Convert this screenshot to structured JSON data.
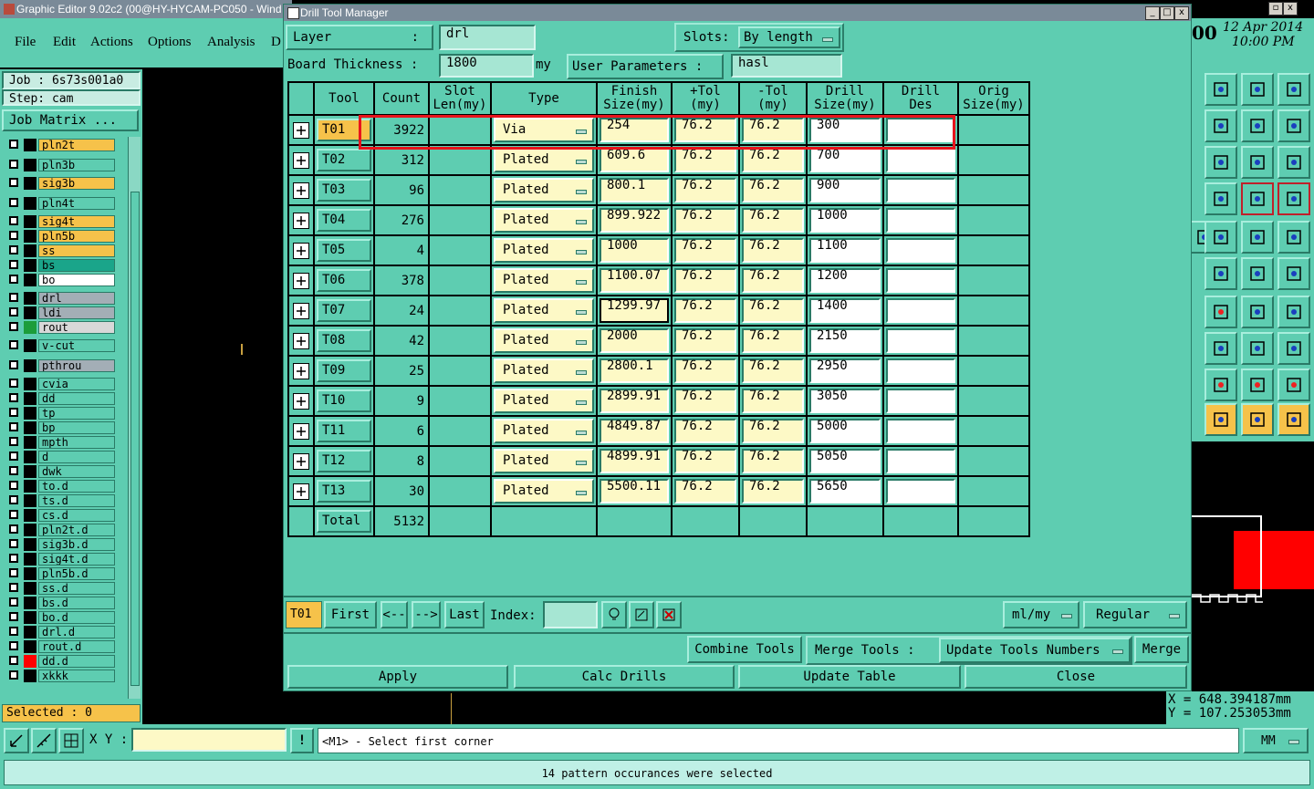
{
  "app": {
    "title": "Graphic Editor 9.02c2 (00@HY-HYCAM-PC050 - Wind",
    "menu": [
      "File",
      "Edit",
      "Actions",
      "Options",
      "Analysis",
      "D"
    ],
    "job_label": "Job : 6s73s001a0",
    "step_label": "Step: cam",
    "job_matrix_button": "Job Matrix ...",
    "selected_label": "Selected : 0",
    "xy_label": "X Y :",
    "prompt": "<M1> - Select first corner",
    "units": "MM",
    "status_message": "14 pattern occurances were selected",
    "date": "12 Apr 2014",
    "time": "10:00 PM",
    "time_prefix": "00",
    "coord_x": "X = 648.394187mm",
    "coord_y": "Y = 107.253053mm",
    "layers": [
      {
        "name": "pln2t",
        "color": "#f6c24a"
      },
      {
        "name": "pln3b",
        "color": "#5ecdb1"
      },
      {
        "name": "sig3b",
        "color": "#f6c24a"
      },
      {
        "name": "pln4t",
        "color": "#5ecdb1"
      },
      {
        "name": "sig4t",
        "color": "#f6c24a"
      },
      {
        "name": "pln5b",
        "color": "#f6c24a"
      },
      {
        "name": "ss",
        "color": "#f6c24a"
      },
      {
        "name": "bs",
        "color": "#1aa58a"
      },
      {
        "name": "bo",
        "color": "#ffffff"
      },
      {
        "name": "drl",
        "color": "#a3aeb6"
      },
      {
        "name": "ldi",
        "color": "#a3aeb6"
      },
      {
        "name": "rout",
        "color": "#d8d8d8"
      },
      {
        "name": "v-cut",
        "color": "#5ecdb1"
      },
      {
        "name": "pthrou",
        "color": "#a3aeb6"
      },
      {
        "name": "cvia",
        "color": "#5ecdb1"
      },
      {
        "name": "dd",
        "color": "#5ecdb1"
      },
      {
        "name": "tp",
        "color": "#5ecdb1"
      },
      {
        "name": "bp",
        "color": "#5ecdb1"
      },
      {
        "name": "mpth",
        "color": "#5ecdb1"
      },
      {
        "name": "d",
        "color": "#5ecdb1"
      },
      {
        "name": "dwk",
        "color": "#5ecdb1"
      },
      {
        "name": "to.d",
        "color": "#5ecdb1"
      },
      {
        "name": "ts.d",
        "color": "#5ecdb1"
      },
      {
        "name": "cs.d",
        "color": "#5ecdb1"
      },
      {
        "name": "pln2t.d",
        "color": "#5ecdb1"
      },
      {
        "name": "sig3b.d",
        "color": "#5ecdb1"
      },
      {
        "name": "sig4t.d",
        "color": "#5ecdb1"
      },
      {
        "name": "pln5b.d",
        "color": "#5ecdb1"
      },
      {
        "name": "ss.d",
        "color": "#5ecdb1"
      },
      {
        "name": "bs.d",
        "color": "#5ecdb1"
      },
      {
        "name": "bo.d",
        "color": "#5ecdb1"
      },
      {
        "name": "drl.d",
        "color": "#5ecdb1"
      },
      {
        "name": "rout.d",
        "color": "#5ecdb1"
      },
      {
        "name": "dd.d",
        "color": "#5ecdb1"
      },
      {
        "name": "xkkk",
        "color": "#5ecdb1"
      }
    ]
  },
  "dialog": {
    "title": "Drill Tool Manager",
    "layer_label": "Layer",
    "layer_value": "drl",
    "slots_label": "Slots:",
    "slots_value": "By length",
    "board_thickness_label": "Board Thickness :",
    "board_thickness_value": "1800",
    "board_thickness_unit": "my",
    "user_params_label": "User Parameters :",
    "user_params_value": "hasl",
    "columns": [
      "Tool",
      "Count",
      "Slot Len(my)",
      "Type",
      "Finish Size(my)",
      "+Tol (my)",
      "-Tol (my)",
      "Drill Size(my)",
      "Drill Des",
      "Orig Size(my)"
    ],
    "rows": [
      {
        "tool": "T01",
        "count": "3922",
        "type": "Via",
        "finish": "254",
        "ptol": "76.2",
        "mtol": "76.2",
        "drill": "300"
      },
      {
        "tool": "T02",
        "count": "312",
        "type": "Plated",
        "finish": "609.6",
        "ptol": "76.2",
        "mtol": "76.2",
        "drill": "700"
      },
      {
        "tool": "T03",
        "count": "96",
        "type": "Plated",
        "finish": "800.1",
        "ptol": "76.2",
        "mtol": "76.2",
        "drill": "900"
      },
      {
        "tool": "T04",
        "count": "276",
        "type": "Plated",
        "finish": "899.922",
        "ptol": "76.2",
        "mtol": "76.2",
        "drill": "1000"
      },
      {
        "tool": "T05",
        "count": "4",
        "type": "Plated",
        "finish": "1000",
        "ptol": "76.2",
        "mtol": "76.2",
        "drill": "1100"
      },
      {
        "tool": "T06",
        "count": "378",
        "type": "Plated",
        "finish": "1100.07",
        "ptol": "76.2",
        "mtol": "76.2",
        "drill": "1200"
      },
      {
        "tool": "T07",
        "count": "24",
        "type": "Plated",
        "finish": "1299.97",
        "ptol": "76.2",
        "mtol": "76.2",
        "drill": "1400"
      },
      {
        "tool": "T08",
        "count": "42",
        "type": "Plated",
        "finish": "2000",
        "ptol": "76.2",
        "mtol": "76.2",
        "drill": "2150"
      },
      {
        "tool": "T09",
        "count": "25",
        "type": "Plated",
        "finish": "2800.1",
        "ptol": "76.2",
        "mtol": "76.2",
        "drill": "2950"
      },
      {
        "tool": "T10",
        "count": "9",
        "type": "Plated",
        "finish": "2899.91",
        "ptol": "76.2",
        "mtol": "76.2",
        "drill": "3050"
      },
      {
        "tool": "T11",
        "count": "6",
        "type": "Plated",
        "finish": "4849.87",
        "ptol": "76.2",
        "mtol": "76.2",
        "drill": "5000"
      },
      {
        "tool": "T12",
        "count": "8",
        "type": "Plated",
        "finish": "4899.91",
        "ptol": "76.2",
        "mtol": "76.2",
        "drill": "5050"
      },
      {
        "tool": "T13",
        "count": "30",
        "type": "Plated",
        "finish": "5500.11",
        "ptol": "76.2",
        "mtol": "76.2",
        "drill": "5650"
      }
    ],
    "total_label": "Total",
    "total_value": "5132",
    "current_tool": "T01",
    "nav": {
      "first": "First",
      "prev": "<--",
      "next": "-->",
      "last": "Last",
      "index_label": "Index:"
    },
    "units_select": "ml/my",
    "mode_select": "Regular",
    "combine_tools": "Combine Tools",
    "merge_tools_label": "Merge Tools :",
    "update_tools_numbers": "Update Tools Numbers",
    "merge": "Merge",
    "apply": "Apply",
    "calc_drills": "Calc Drills",
    "update_table": "Update Table",
    "close": "Close"
  },
  "highlight_color": "#e8141c"
}
